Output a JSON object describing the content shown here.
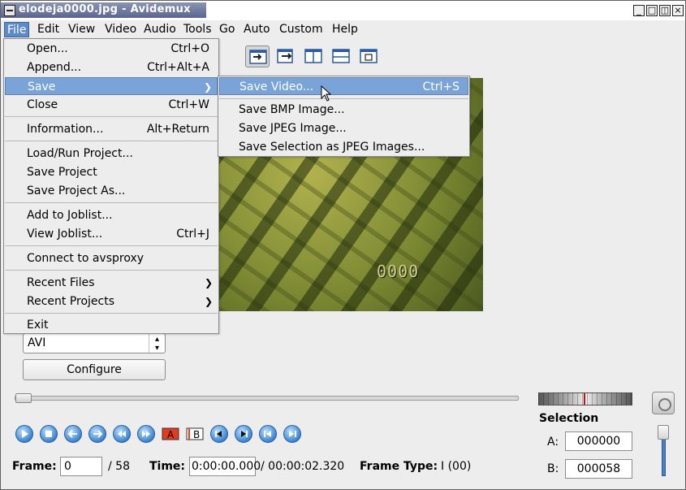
{
  "window": {
    "title": "elodeja0000.jpg - Avidemux",
    "controls": [
      "_",
      "□",
      "×"
    ]
  },
  "menubar": {
    "items": [
      "File",
      "Edit",
      "View",
      "Video",
      "Audio",
      "Tools",
      "Go",
      "Auto",
      "Custom",
      "Help"
    ],
    "active": "File"
  },
  "file_menu": {
    "items": [
      {
        "label": "Open...",
        "accel": "Ctrl+O"
      },
      {
        "label": "Append...",
        "accel": "Ctrl+Alt+A"
      },
      {
        "label": "Save",
        "submenu": true,
        "highlighted": true
      },
      {
        "label": "Close",
        "accel": "Ctrl+W"
      },
      {
        "label": "Information...",
        "accel": "Alt+Return"
      },
      {
        "label": "Load/Run Project..."
      },
      {
        "label": "Save Project"
      },
      {
        "label": "Save Project As..."
      },
      {
        "label": "Add to Joblist..."
      },
      {
        "label": "View Joblist...",
        "accel": "Ctrl+J"
      },
      {
        "label": "Connect to avsproxy"
      },
      {
        "label": "Recent Files",
        "submenu": true
      },
      {
        "label": "Recent Projects",
        "submenu": true
      },
      {
        "label": "Exit"
      }
    ]
  },
  "save_submenu": {
    "items": [
      {
        "label": "Save Video...",
        "accel": "Ctrl+S",
        "highlighted": true
      },
      {
        "label": "Save BMP Image..."
      },
      {
        "label": "Save JPEG Image..."
      },
      {
        "label": "Save Selection as JPEG Images..."
      }
    ]
  },
  "video": {
    "overlay_text": "0000"
  },
  "left_panel": {
    "format_select": "AVI",
    "configure_label": "Configure"
  },
  "playback": {
    "ab_labels": [
      "A",
      "B"
    ]
  },
  "status": {
    "frame_label": "Frame:",
    "frame_value": "0",
    "frame_total": "/ 58",
    "time_label": "Time:",
    "time_value": "0:00:00.000",
    "time_total": "/ 00:00:02.320",
    "frame_type_label": "Frame Type:",
    "frame_type_value": "I (00)"
  },
  "selection": {
    "title": "Selection",
    "a_label": "A:",
    "a_value": "000000",
    "b_label": "B:",
    "b_value": "000058"
  },
  "colors": {
    "menu_highlight": "#7aa3d8",
    "playback_blue": "#3a84d0",
    "marker_red": "#d01010"
  }
}
